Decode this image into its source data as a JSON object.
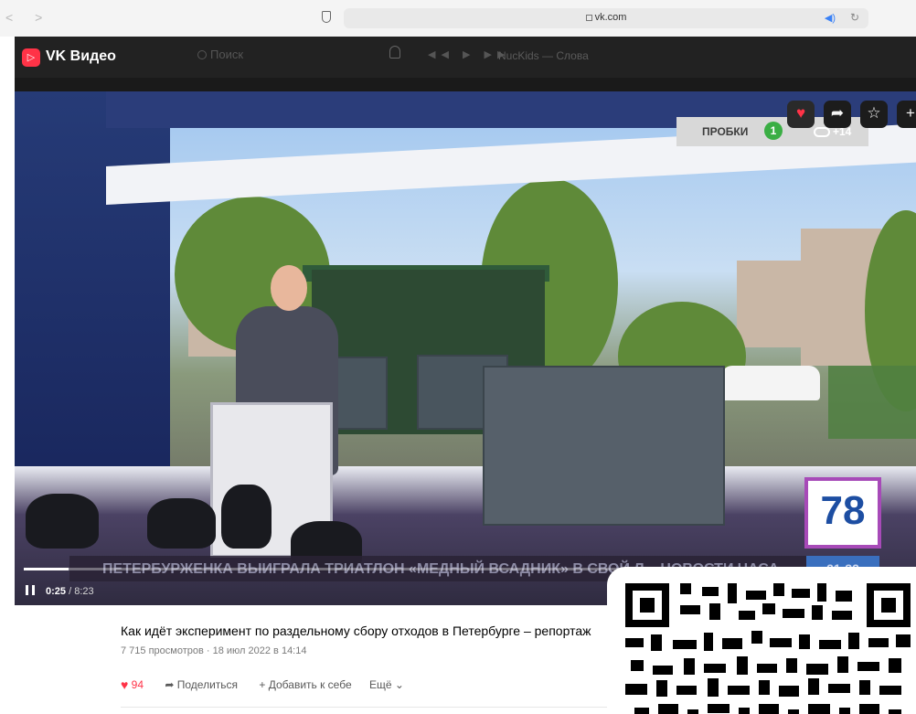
{
  "browser": {
    "url": "vk.com"
  },
  "header": {
    "app_title": "VK Видео",
    "search_placeholder": "Поиск",
    "now_playing": "NucKids — Слова"
  },
  "player": {
    "traffic_label": "ПРОБКИ",
    "traffic_score": "1",
    "temperature": "+14",
    "channel_logo": "78",
    "ticker_text": "ПЕТЕРБУРЖЕНКА ВЫИГРАЛА ТРИАТЛОН «МЕДНЫЙ ВСАДНИК»  В СВОЙ Л...  НОВОСТИ ЧАСА",
    "broadcast_time": "21:32",
    "current_time": "0:25",
    "total_time": "8:23",
    "progress_fraction": 0.05
  },
  "video": {
    "title": "Как идёт эксперимент по раздельному сбору отходов в Петербурге – репортаж",
    "meta": "7 715 просмотров · 18 июл 2022 в 14:14",
    "likes": "94",
    "share_label": "Поделиться",
    "add_label": "Добавить к себе",
    "more_label": "Ещё"
  },
  "icons": {
    "like": "heart-icon",
    "share": "share-arrow-icon",
    "favorite": "star-icon",
    "add": "plus-icon",
    "pause": "pause-icon",
    "bell": "bell-icon",
    "search": "search-icon",
    "logo": "vk-video-logo-icon"
  },
  "colors": {
    "accent": "#ff3347",
    "header_bg": "#222222"
  }
}
